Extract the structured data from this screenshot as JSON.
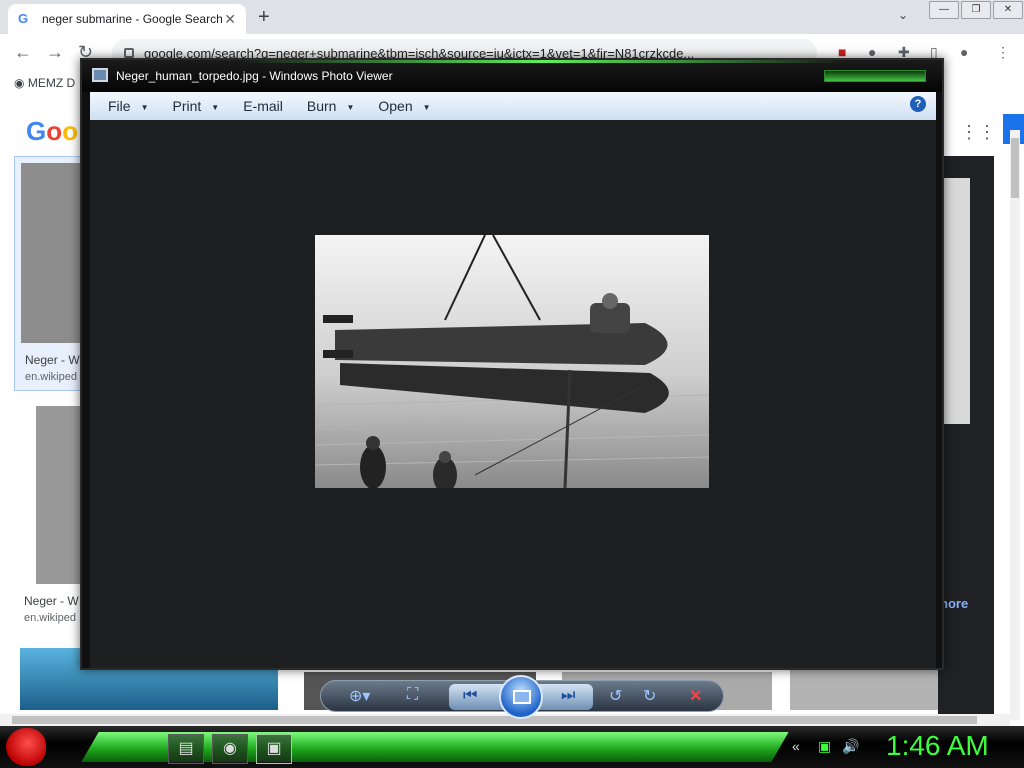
{
  "browser": {
    "tab_title": "neger submarine - Google Search",
    "tab_close": "✕",
    "new_tab": "+",
    "tab_search": "⌄",
    "url": "google.com/search?q=neger+submarine&tbm=isch&source=iu&ictx=1&vet=1&fir=N81crzkcde...",
    "bookmark_label": "MEMZ D",
    "win_buttons": [
      "—",
      "❐",
      "✕"
    ]
  },
  "google": {
    "logo": "Goo",
    "more_link": "nore",
    "results": [
      {
        "title": "Neger - W",
        "site": "en.wikiped"
      },
      {
        "title": "Neger - W",
        "site": "en.wikiped"
      }
    ]
  },
  "photo_viewer": {
    "title": "Neger_human_torpedo.jpg - Windows Photo Viewer",
    "menu": [
      {
        "label": "File"
      },
      {
        "label": "Print"
      },
      {
        "label": "E-mail"
      },
      {
        "label": "Burn"
      },
      {
        "label": "Open"
      }
    ],
    "help": "?"
  },
  "taskbar": {
    "clock": "1:46 AM"
  },
  "colors": {
    "taskbar_accent": "#3dff3d",
    "title_bar": "#050505",
    "menu_bar": "#dbe7f5"
  }
}
